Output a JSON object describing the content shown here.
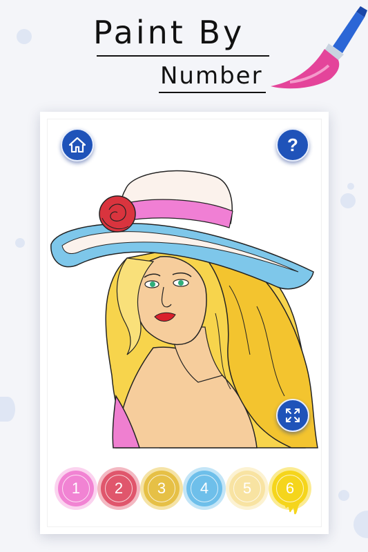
{
  "title": {
    "line1": "Paint By",
    "line2": "Number"
  },
  "toolbar": {
    "home_icon": "home-icon",
    "help_label": "?",
    "expand_icon": "expand-icon"
  },
  "palette": [
    {
      "number": "1",
      "color": "#f183d3"
    },
    {
      "number": "2",
      "color": "#e0566c"
    },
    {
      "number": "3",
      "color": "#e6c046"
    },
    {
      "number": "4",
      "color": "#6ebfea"
    },
    {
      "number": "5",
      "color": "#f8e3a2"
    },
    {
      "number": "6",
      "color": "#f5d51c"
    }
  ],
  "colors": {
    "accent": "#1f53b9",
    "background": "#f4f5f9",
    "brush_head": "#e4449a",
    "brush_handle": "#2b66d6"
  }
}
